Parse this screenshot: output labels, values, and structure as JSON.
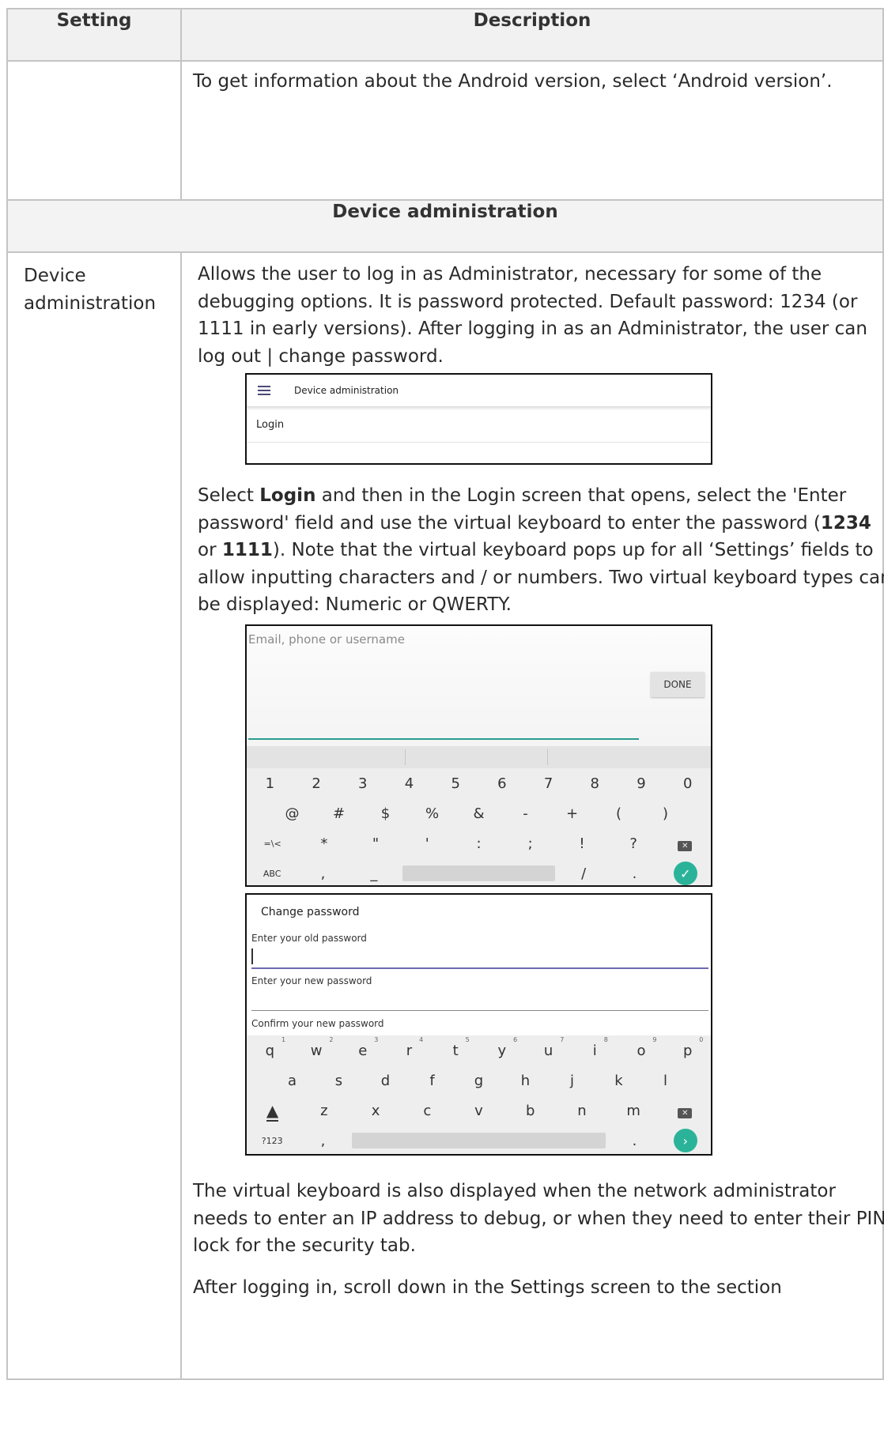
{
  "table": {
    "headers": [
      "Setting",
      "Description"
    ],
    "row_android": "To get information about the Android version, select ‘Android version’.",
    "section_title": "Device administration",
    "setting_name": "Device administration"
  },
  "desc": {
    "para1": "Allows the user to log in as Administrator, necessary for some of the debugging options. It is password protected. Default password: 1234 (or 1111 in early versions). After logging in as an Administrator, the user can log out | change password.",
    "para2_a": "Select ",
    "para2_login": "Login",
    "para2_b": " and then in the Login screen that opens, select the 'Enter password' field and use the virtual keyboard to enter the password (",
    "para2_1234": "1234",
    "para2_or": " or ",
    "para2_1111": "1111",
    "para2_c": "). Note that the virtual keyboard pops up for all ‘Settings’ fields to allow inputting characters and / or numbers. Two virtual keyboard types can be displayed: Numeric or QWERTY.",
    "para3": "The virtual keyboard is also displayed when the network administrator needs to enter an IP address to debug, or when they need to enter their PIN lock for the security tab.",
    "para4": "After logging in, scroll down in the Settings screen to the section"
  },
  "shot1": {
    "title": "Device administration",
    "item": "Login"
  },
  "shot2": {
    "placeholder": "Email, phone or username",
    "done": "DONE",
    "row1": [
      "1",
      "2",
      "3",
      "4",
      "5",
      "6",
      "7",
      "8",
      "9",
      "0"
    ],
    "row2": [
      "@",
      "#",
      "$",
      "%",
      "&",
      "-",
      "+",
      "(",
      ")"
    ],
    "row3": [
      "=\\<",
      "*",
      "\"",
      "'",
      ":",
      ";",
      "!",
      "?"
    ],
    "abc": "ABC",
    "comma": ",",
    "underscore": "_",
    "slash": "/",
    "dot": "."
  },
  "shot3": {
    "title": "Change password",
    "old": "Enter your old password",
    "new": "Enter your new password",
    "confirm": "Confirm your new password",
    "row1": [
      "q",
      "w",
      "e",
      "r",
      "t",
      "y",
      "u",
      "i",
      "o",
      "p"
    ],
    "row1_sup": [
      "1",
      "2",
      "3",
      "4",
      "5",
      "6",
      "7",
      "8",
      "9",
      "0"
    ],
    "row2": [
      "a",
      "s",
      "d",
      "f",
      "g",
      "h",
      "j",
      "k",
      "l"
    ],
    "row3": [
      "z",
      "x",
      "c",
      "v",
      "b",
      "n",
      "m"
    ],
    "num": "?123",
    "comma": ",",
    "dot": "."
  }
}
